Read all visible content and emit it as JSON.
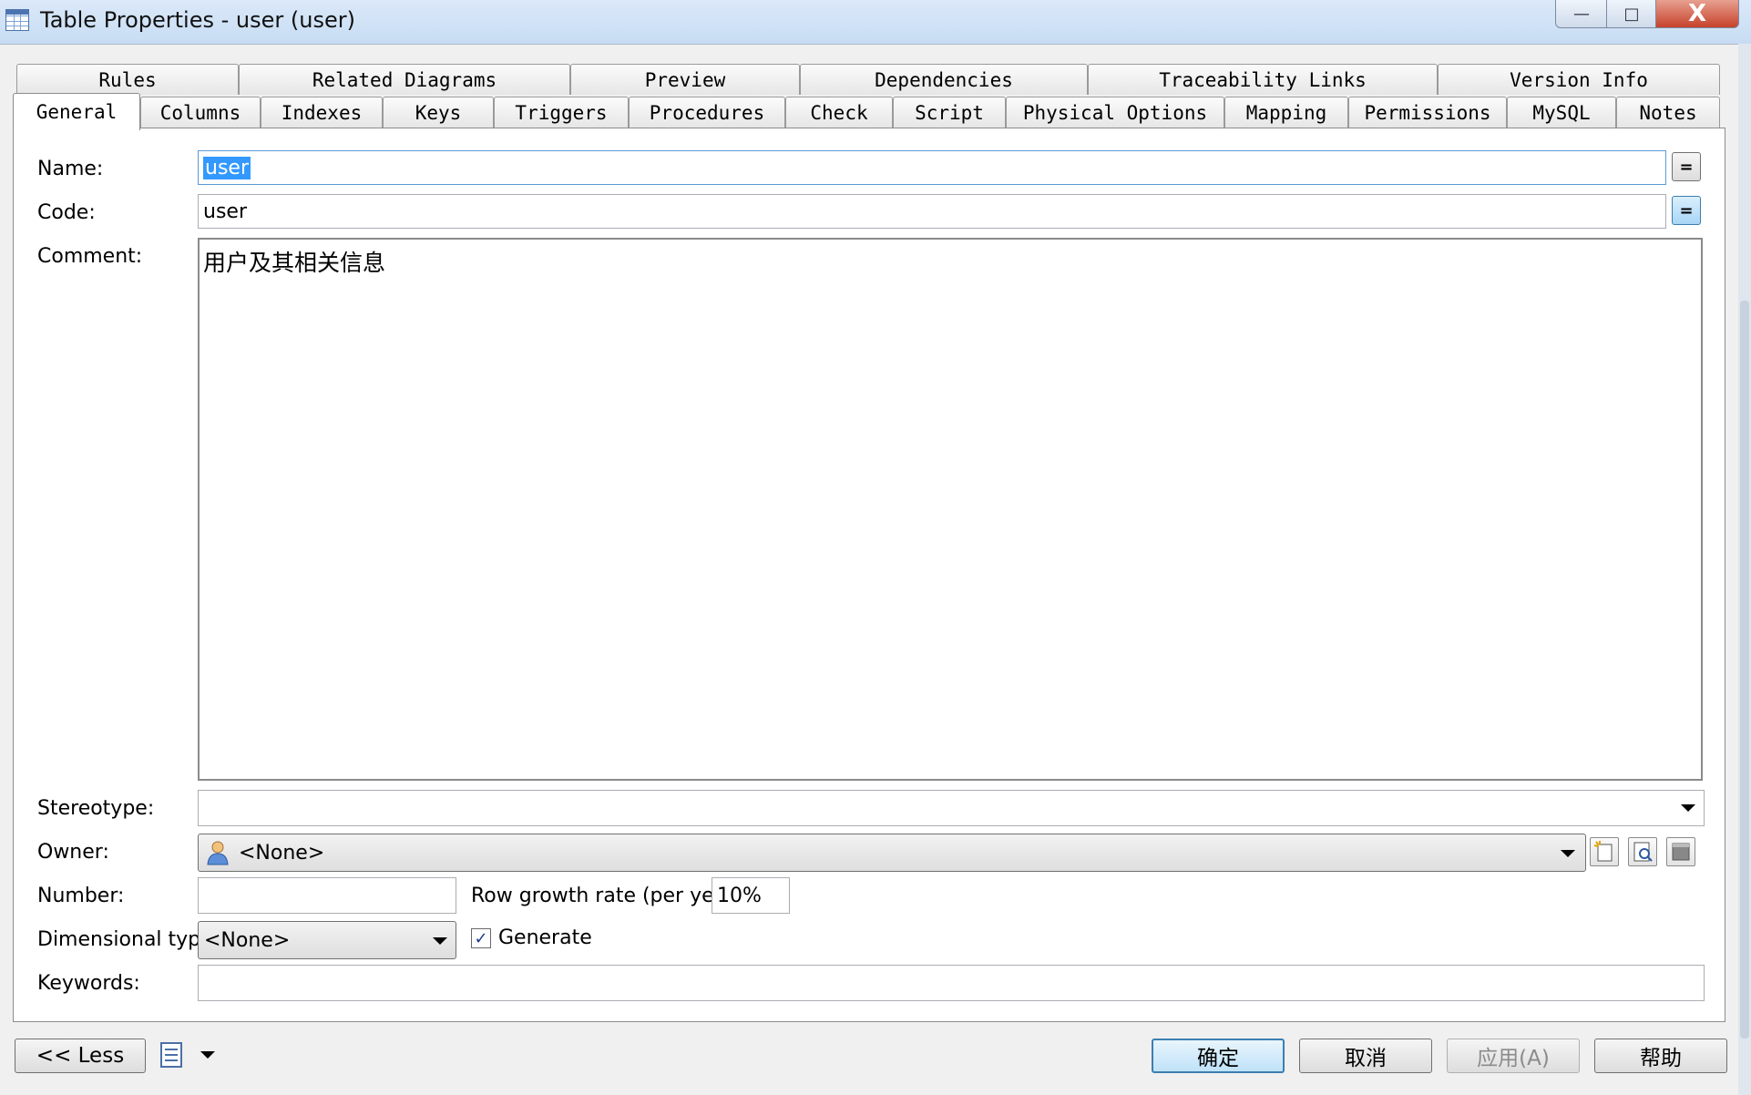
{
  "window": {
    "title": "Table Properties - user (user)",
    "minimize_symbol": "—",
    "maximize_symbol": "□",
    "close_symbol": "X"
  },
  "tabs": {
    "row1": [
      "Rules",
      "Related Diagrams",
      "Preview",
      "Dependencies",
      "Traceability Links",
      "Version Info"
    ],
    "row2": [
      "General",
      "Columns",
      "Indexes",
      "Keys",
      "Triggers",
      "Procedures",
      "Check",
      "Script",
      "Physical Options",
      "Mapping",
      "Permissions",
      "MySQL",
      "Notes"
    ],
    "active": "General"
  },
  "form": {
    "name_label": "Name:",
    "name_value": "user",
    "code_label": "Code:",
    "code_value": "user",
    "comment_label": "Comment:",
    "comment_value": "用户及其相关信息",
    "stereotype_label": "Stereotype:",
    "stereotype_value": "",
    "owner_label": "Owner:",
    "owner_value": "<None>",
    "number_label": "Number:",
    "number_value": "",
    "row_growth_label": "Row growth rate (per year):",
    "row_growth_value": "10%",
    "dimensional_label": "Dimensional type:",
    "dimensional_value": "<None>",
    "generate_label": "Generate",
    "generate_checked": true,
    "keywords_label": "Keywords:",
    "keywords_value": "",
    "eq_symbol": "="
  },
  "footer": {
    "less_label": "<< Less",
    "ok_label": "确定",
    "cancel_label": "取消",
    "apply_label": "应用(A)",
    "help_label": "帮助"
  },
  "colors": {
    "selection": "#3399ff",
    "default_button_border": "#3c7fb1"
  }
}
